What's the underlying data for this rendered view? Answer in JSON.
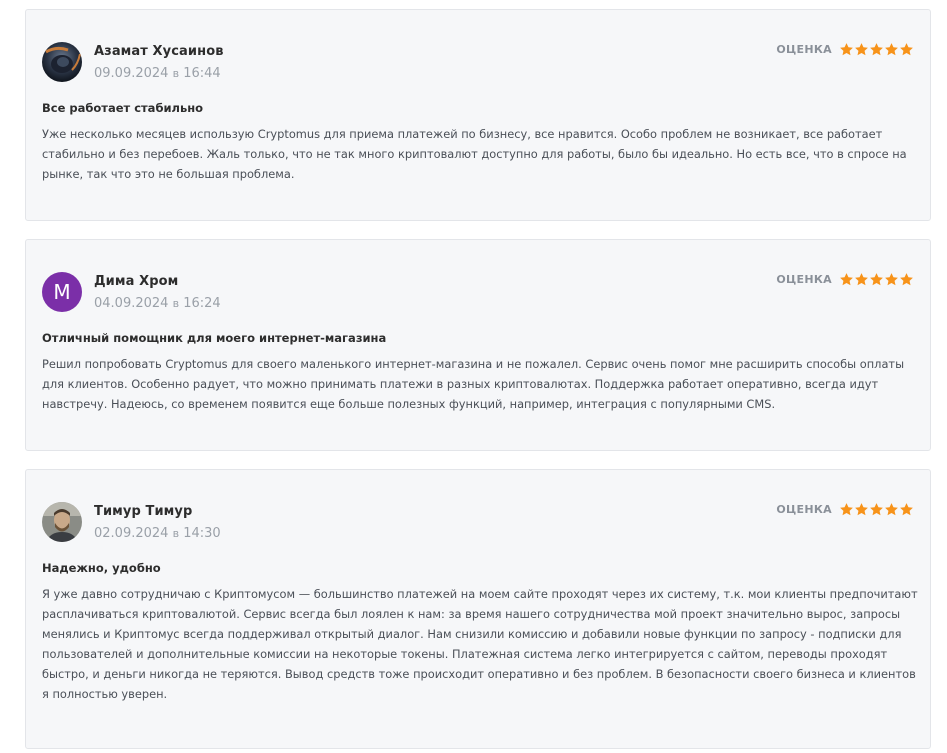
{
  "rating_label": "ОЦЕНКА",
  "star_color": "#f7931a",
  "reviews": [
    {
      "author": "Азамат Хусаинов",
      "date": "09.09.2024",
      "date_sep": "в",
      "time": "16:44",
      "rating": 5,
      "avatar": "photo-avatar",
      "title": "Все работает стабильно",
      "text": "Уже несколько месяцев использую Cryptomus для приема платежей по бизнесу, все нравится. Особо проблем не возникает, все работает стабильно и без перебоев. Жаль только, что не так много криптовалют доступно для работы, было бы идеально. Но есть все, что в спросе на рынке, так что это не большая проблема."
    },
    {
      "author": "Дима Хром",
      "date": "04.09.2024",
      "date_sep": "в",
      "time": "16:24",
      "rating": 5,
      "avatar_letter": "M",
      "avatar_color": "#7b2fa8",
      "title": "Отличный помощник для моего интернет-магазина",
      "text": "Решил попробовать Cryptomus для своего маленького интернет-магазина и не пожалел. Сервис очень помог мне расширить способы оплаты для клиентов. Особенно радует, что можно принимать платежи в разных криптовалютах. Поддержка работает оперативно, всегда идут навстречу. Надеюсь, со временем появится еще больше полезных функций, например, интеграция с популярными CMS."
    },
    {
      "author": "Тимур Тимур",
      "date": "02.09.2024",
      "date_sep": "в",
      "time": "14:30",
      "rating": 5,
      "avatar": "photo-avatar",
      "title": "Надежно, удобно",
      "text": "Я уже давно сотрудничаю с Криптомусом — большинство платежей на моем сайте проходят через их систему, т.к. мои клиенты предпочитают расплачиваться криптовалютой. Сервис всегда был лоялен к нам: за время нашего сотрудничества мой проект значительно вырос, запросы менялись и Криптомус всегда поддерживал открытый диалог. Нам снизили комиссию и добавили новые функции по запросу - подписки для пользователей и дополнительные комиссии на некоторые токены. Платежная система легко интегрируется с сайтом, переводы проходят быстро, и деньги никогда не теряются. Вывод средств тоже происходит оперативно и без проблем. В безопасности своего бизнеса и клиентов я полностью уверен."
    }
  ]
}
